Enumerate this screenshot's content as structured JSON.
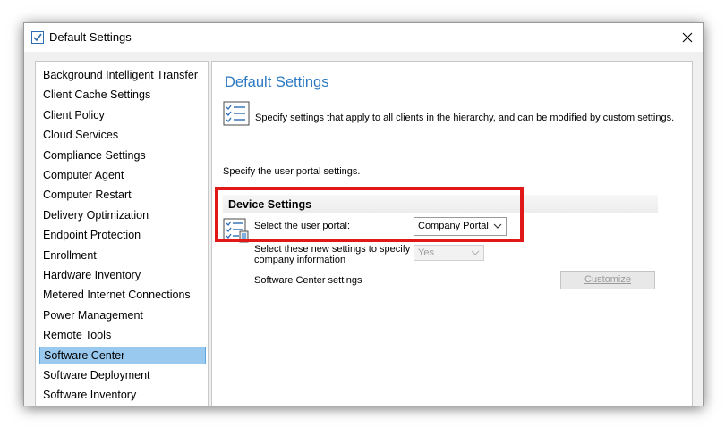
{
  "window": {
    "title": "Default Settings"
  },
  "sidebar": {
    "items": [
      {
        "label": "Background Intelligent Transfer",
        "selected": false
      },
      {
        "label": "Client Cache Settings",
        "selected": false
      },
      {
        "label": "Client Policy",
        "selected": false
      },
      {
        "label": "Cloud Services",
        "selected": false
      },
      {
        "label": "Compliance Settings",
        "selected": false
      },
      {
        "label": "Computer Agent",
        "selected": false
      },
      {
        "label": "Computer Restart",
        "selected": false
      },
      {
        "label": "Delivery Optimization",
        "selected": false
      },
      {
        "label": "Endpoint Protection",
        "selected": false
      },
      {
        "label": "Enrollment",
        "selected": false
      },
      {
        "label": "Hardware Inventory",
        "selected": false
      },
      {
        "label": "Metered Internet Connections",
        "selected": false
      },
      {
        "label": "Power Management",
        "selected": false
      },
      {
        "label": "Remote Tools",
        "selected": false
      },
      {
        "label": "Software Center",
        "selected": true
      },
      {
        "label": "Software Deployment",
        "selected": false
      },
      {
        "label": "Software Inventory",
        "selected": false
      }
    ]
  },
  "main": {
    "title": "Default Settings",
    "description": "Specify settings that apply to all clients in the hierarchy, and can be modified by custom settings.",
    "portal_description": "Specify the user portal settings.",
    "group": {
      "title": "Device Settings",
      "portal_label": "Select the user portal:",
      "portal_value": "Company Portal",
      "company_info_label": "Select these new settings to specify company information",
      "company_info_value": "Yes",
      "software_center_label": "Software Center settings",
      "customize_label": "Customize"
    }
  },
  "colors": {
    "accent_title": "#2b79c2",
    "selection": "#99c9ef",
    "highlight": "#e01818"
  }
}
